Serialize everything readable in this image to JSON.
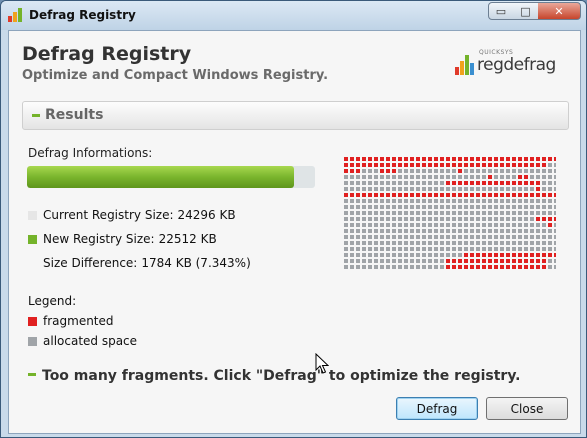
{
  "window": {
    "title": "Defrag Registry",
    "controls": {
      "minimize": "▭",
      "maximize": "□",
      "close": "✕"
    }
  },
  "header": {
    "title": "Defrag Registry",
    "subtitle": "Optimize and Compact Windows Registry.",
    "logo": {
      "brand": "QUICKSYS",
      "name": "regdefrag"
    }
  },
  "results": {
    "section_label": "Results",
    "info_title": "Defrag Informations:",
    "progress_fraction": 0.927,
    "current_size_label": "Current Registry Size:",
    "current_size_value": "24296 KB",
    "new_size_label": "New Registry Size:",
    "new_size_value": "22512 KB",
    "diff_label": "Size Difference:",
    "diff_value": "1784 KB (7.343%)"
  },
  "legend": {
    "title": "Legend:",
    "fragmented": "fragmented",
    "allocated": "allocated space"
  },
  "colors": {
    "green": "#74b32a",
    "fragmented": "#e02020",
    "allocated": "#a0a4a8",
    "current_swatch": "#e6e6e6"
  },
  "message": "Too many fragments. Click \"Defrag\" to optimize the registry.",
  "buttons": {
    "defrag": "Defrag",
    "close": "Close"
  },
  "fragment_map": {
    "rows": [
      "RRRRRRRRRRRRRRRRRRRRRRRRRRRRRRRRRRRR",
      "RRRRRRRRRRRRRRRRRRRRRRRRRRRRRRRRRRGG",
      "RRRGGGRRRGGGGGGGGGGRGGGGGGGGGGGGGGGG",
      "GGGGGGGGGGGGGGGGGGGGGGGGRGGGGRRGGGGG",
      "GGGGGGGGGGGGGGGGGRRRRRRRRRRRRRRRRGGG",
      "GGGGGGGGGGGGGGGGGGGGGGGGGGGGGGGGRGGG",
      "RRRRRRRRRRRRRRRRRRRRRRRRRRRRRRRRRRRR",
      "GGGGGGGGGGGGGGGGGGGGGGGGGGGGGGGGGGGG",
      "GGGGGGGGGGGGGGGGGGGGGGGGGGGGGGGGGGGG",
      "GGGGGGGGGGGGGGGGGGGGGGGGGGGGGGGGGGGG",
      "GGGGGGGGGGGGGGGGGGGGGGGGGGGGGGGGRRRR",
      "GGGGGGGGGGGGGGGGGGGGGGGGGGGGGGGGGGRG",
      "GGGGGGGGGGGGGGGGGGGGGGGGGGGGGGGGGGGG",
      "GGGGGGGGGGGGGGGGGGGGGGGGGGGGGGGGGGGG",
      "GGGGGGGGGGGGGGGGGGGGGGGGGGGGGGGGGGGG",
      "GGGGGGGGGGGGGGGGGGGGGGGGGGGGGGGGGGGG",
      "GGGGGGGGGGGGGGGGGGGGRRRRRRRRRRRRRRRR",
      "GGGGGGGGGGGGGGGGGRRRRRRRRRRRRRRRRRGG",
      "GGGGGGGGGGGGGGGGGRRRRRRRRRRRRRRRRRGG"
    ]
  }
}
